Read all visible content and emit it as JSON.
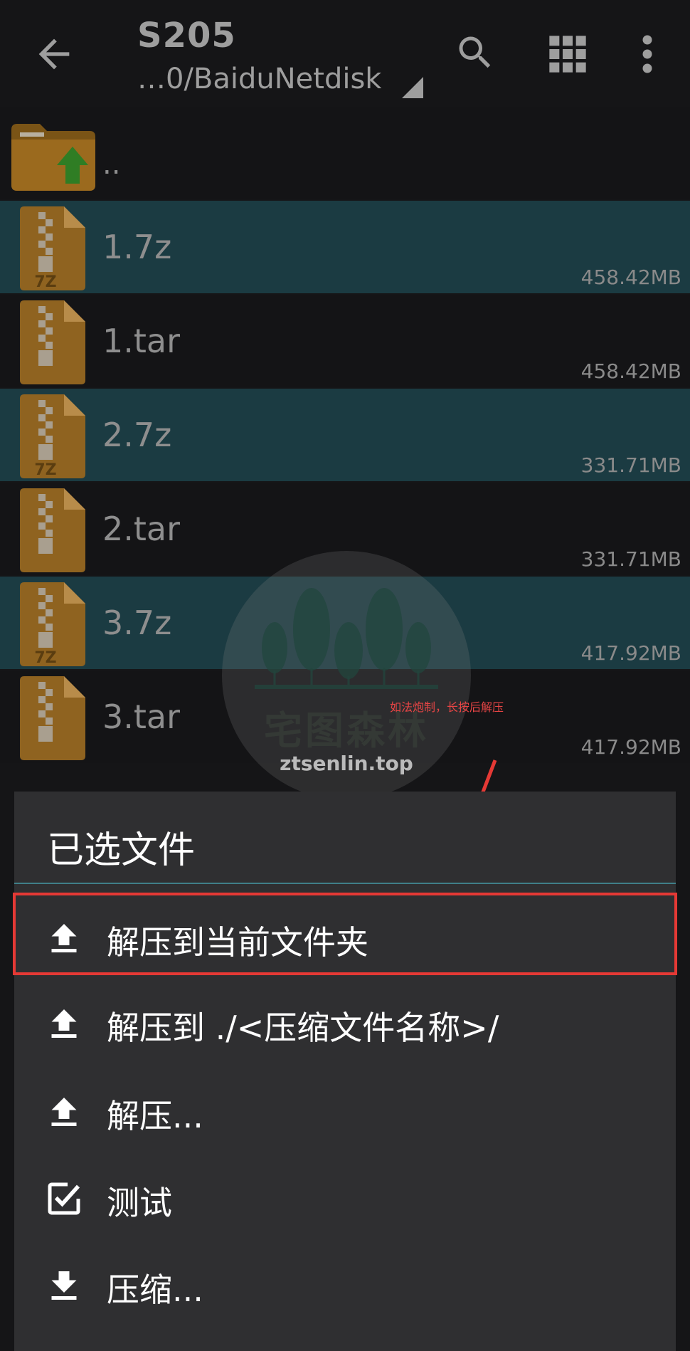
{
  "appbar": {
    "title": "S205",
    "subtitle": "…0/BaiduNetdisk",
    "icons": [
      "arrow-back-icon",
      "search-icon",
      "grid-view-icon",
      "more-vert-icon"
    ]
  },
  "file_list": {
    "parent_label": "..",
    "files": [
      {
        "name": "1.7z",
        "size": "458.42MB",
        "type_badge": "7Z",
        "selected": true
      },
      {
        "name": "1.tar",
        "size": "458.42MB",
        "type_badge": "",
        "selected": false
      },
      {
        "name": "2.7z",
        "size": "331.71MB",
        "type_badge": "7Z",
        "selected": true
      },
      {
        "name": "2.tar",
        "size": "331.71MB",
        "type_badge": "",
        "selected": false
      },
      {
        "name": "3.7z",
        "size": "417.92MB",
        "type_badge": "7Z",
        "selected": true
      },
      {
        "name": "3.tar",
        "size": "417.92MB",
        "type_badge": "",
        "selected": false
      }
    ]
  },
  "watermark": {
    "logo_text": "宅图森林",
    "url": "ztsenlin.top"
  },
  "annotation": {
    "note": "如法炮制，长按后解压"
  },
  "sheet": {
    "title": "已选文件",
    "items": [
      {
        "label": "解压到当前文件夹",
        "icon": "extract-icon"
      },
      {
        "label": "解压到 ./<压缩文件名称>/",
        "icon": "extract-icon"
      },
      {
        "label": "解压...",
        "icon": "extract-icon"
      },
      {
        "label": "测试",
        "icon": "checkbox-icon"
      },
      {
        "label": "压缩...",
        "icon": "compress-icon"
      }
    ]
  },
  "colors": {
    "selected_row": "#1b3b42",
    "sheet_bg": "#2f2f31",
    "highlight": "#e53935",
    "accent_divider": "#3f7f88"
  }
}
